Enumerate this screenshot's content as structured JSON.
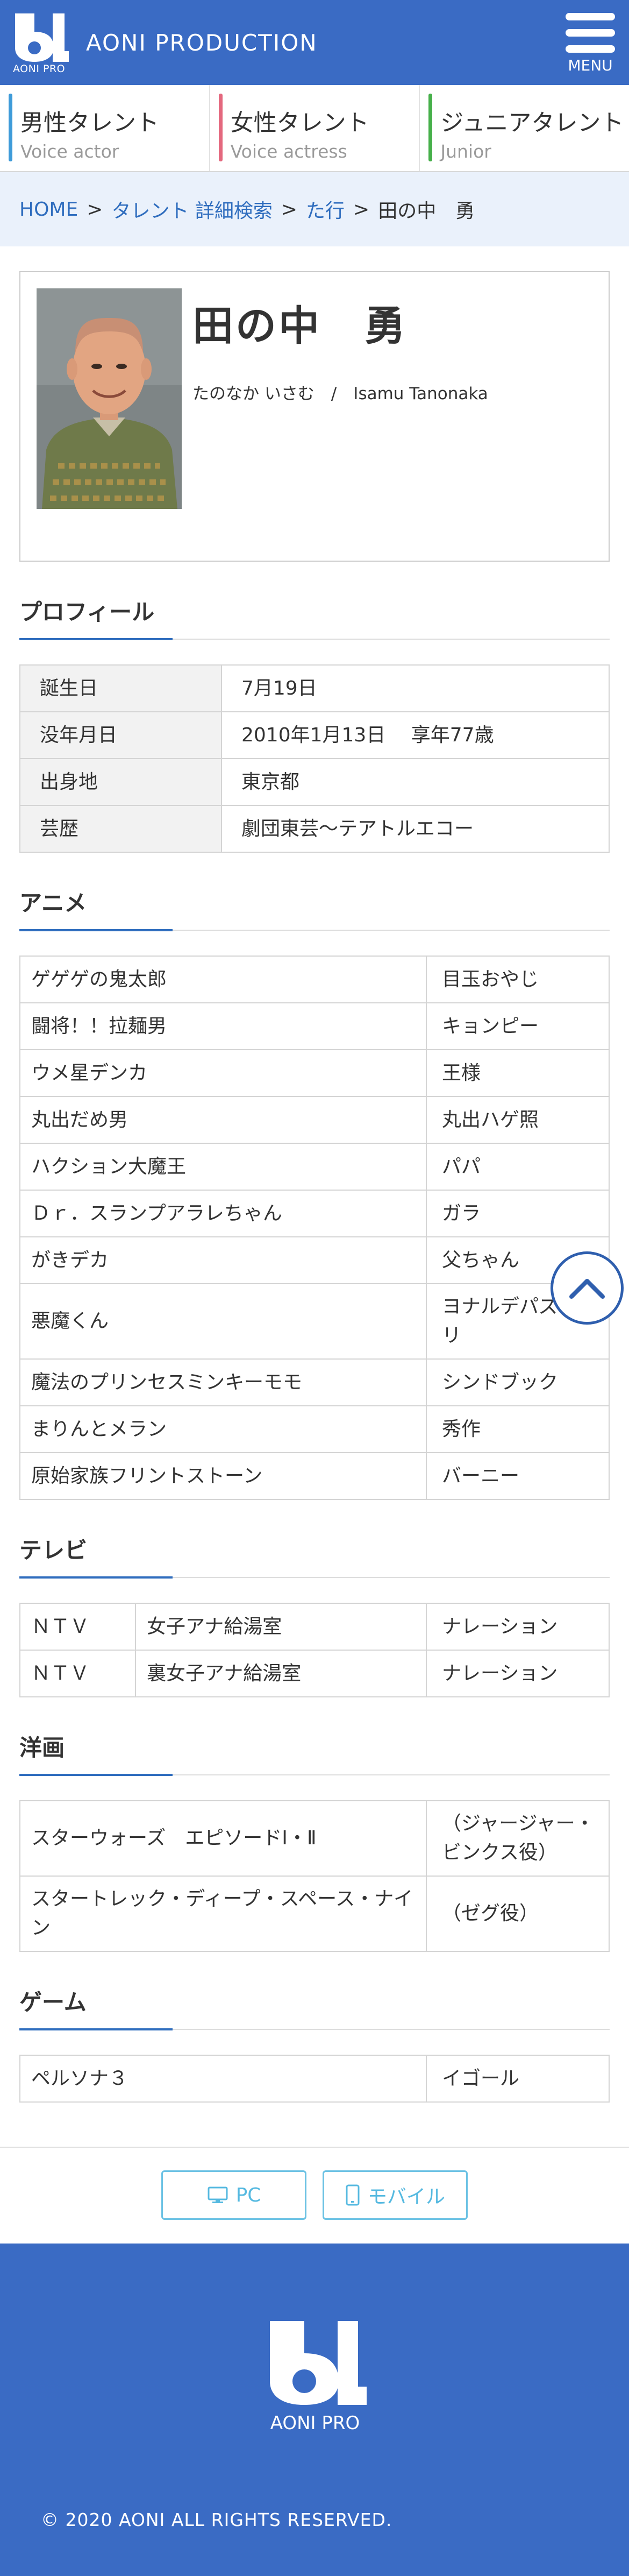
{
  "header": {
    "brand": "AONI PRODUCTION",
    "logo_sub": "AONI PRO",
    "menu_label": "MENU",
    "bg_color": "#3a6bc4"
  },
  "categories": [
    {
      "jp": "男性タレント",
      "en": "Voice actor",
      "color": "#3e9bd9"
    },
    {
      "jp": "女性タレント",
      "en": "Voice actress",
      "color": "#e4687e"
    },
    {
      "jp": "ジュニアタレント",
      "en": "Junior",
      "color": "#46b04a"
    }
  ],
  "breadcrumb": {
    "home": "HOME",
    "search": "タレント 詳細検索",
    "row": "た行",
    "current": "田の中　勇",
    "separator": ">"
  },
  "profile": {
    "name": "田の中　勇",
    "reading": "たのなか いさむ　/　Isamu Tanonaka",
    "section_title": "プロフィール",
    "rows": [
      {
        "k": "誕生日",
        "v": "7月19日"
      },
      {
        "k": "没年月日",
        "v": "2010年1月13日　 享年77歳"
      },
      {
        "k": "出身地",
        "v": "東京都"
      },
      {
        "k": "芸歴",
        "v": "劇団東芸〜テアトルエコー"
      }
    ]
  },
  "anime": {
    "title": "アニメ",
    "rows": [
      {
        "work": "ゲゲゲの鬼太郎",
        "role": "目玉おやじ"
      },
      {
        "work": "闘将！！拉麺男",
        "role": "キョンピー"
      },
      {
        "work": "ウメ星デンカ",
        "role": "王様"
      },
      {
        "work": "丸出だめ男",
        "role": "丸出ハゲ照"
      },
      {
        "work": "ハクション大魔王",
        "role": "パパ"
      },
      {
        "work": "Ｄｒ．スランプアラレちゃん",
        "role": "ガラ"
      },
      {
        "work": "がきデカ",
        "role": "父ちゃん"
      },
      {
        "work": "悪魔くん",
        "role": "ヨナルデパズトーリ"
      },
      {
        "work": "魔法のプリンセスミンキーモモ",
        "role": "シンドブック"
      },
      {
        "work": "まりんとメラン",
        "role": "秀作"
      },
      {
        "work": "原始家族フリントストーン",
        "role": "バーニー"
      }
    ]
  },
  "tv": {
    "title": "テレビ",
    "rows": [
      {
        "station": "ＮＴＶ",
        "program": "女子アナ給湯室",
        "role": "ナレーション"
      },
      {
        "station": "ＮＴＶ",
        "program": "裏女子アナ給湯室",
        "role": "ナレーション"
      }
    ]
  },
  "movies": {
    "title": "洋画",
    "rows": [
      {
        "work": "スターウォーズ　エピソードⅠ・Ⅱ",
        "role": "（ジャージャー・ビンクス役）"
      },
      {
        "work": "スタートレック・ディープ・スペース・ナイン",
        "role": "（ゼグ役）"
      }
    ]
  },
  "games": {
    "title": "ゲーム",
    "rows": [
      {
        "work": "ペルソナ３",
        "role": "イゴール"
      }
    ]
  },
  "switch": {
    "pc": "PC",
    "mobile": "モバイル"
  },
  "footer": {
    "logo_sub": "AONI PRO",
    "copyright": "© 2020 AONI ALL RIGHTS RESERVED."
  }
}
